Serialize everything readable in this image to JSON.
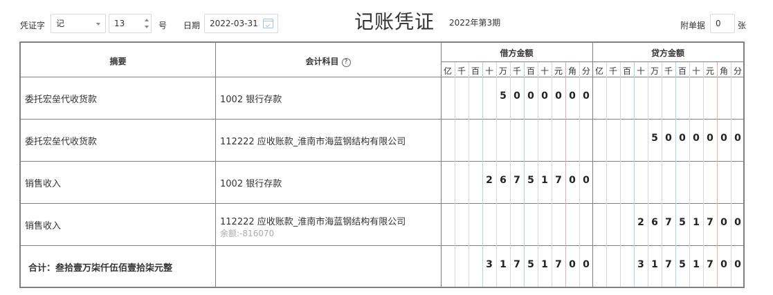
{
  "header": {
    "voucher_word_label": "凭证字",
    "voucher_word_value": "记",
    "voucher_number": "13",
    "number_suffix": "号",
    "date_label": "日期",
    "date_value": "2022-03-31",
    "title": "记账凭证",
    "period": "2022年第3期",
    "attachments_label": "附单据",
    "attachments_value": "0",
    "attachments_unit": "张"
  },
  "table": {
    "col_summary": "摘要",
    "col_account": "会计科目",
    "help_icon": "?",
    "debit_header": "借方金额",
    "credit_header": "贷方金额",
    "units": [
      "亿",
      "千",
      "百",
      "十",
      "万",
      "千",
      "百",
      "十",
      "元",
      "角",
      "分"
    ],
    "rows": [
      {
        "summary": "委托宏垒代收货款",
        "account": "1002 银行存款",
        "balance": "",
        "debit": "5000000",
        "credit": ""
      },
      {
        "summary": "委托宏垒代收货款",
        "account": "112222 应收账款_淮南市海蓝钢结构有限公司",
        "balance": "",
        "debit": "",
        "credit": "5000000"
      },
      {
        "summary": "销售收入",
        "account": "1002 银行存款",
        "balance": "",
        "debit": "26751700",
        "credit": ""
      },
      {
        "summary": "销售收入",
        "account": "112222 应收账款_淮南市海蓝钢结构有限公司",
        "balance": "余额:-816070",
        "debit": "",
        "credit": "26751700"
      }
    ],
    "total_label": "合计：叁拾壹万柒仟伍佰壹拾柒元整",
    "total_debit": "31751700",
    "total_credit": "31751700"
  },
  "colors": {
    "grid_blue": "#a8d4f0",
    "grid_red": "#f3a6a6",
    "border": "#7f7f7f"
  }
}
